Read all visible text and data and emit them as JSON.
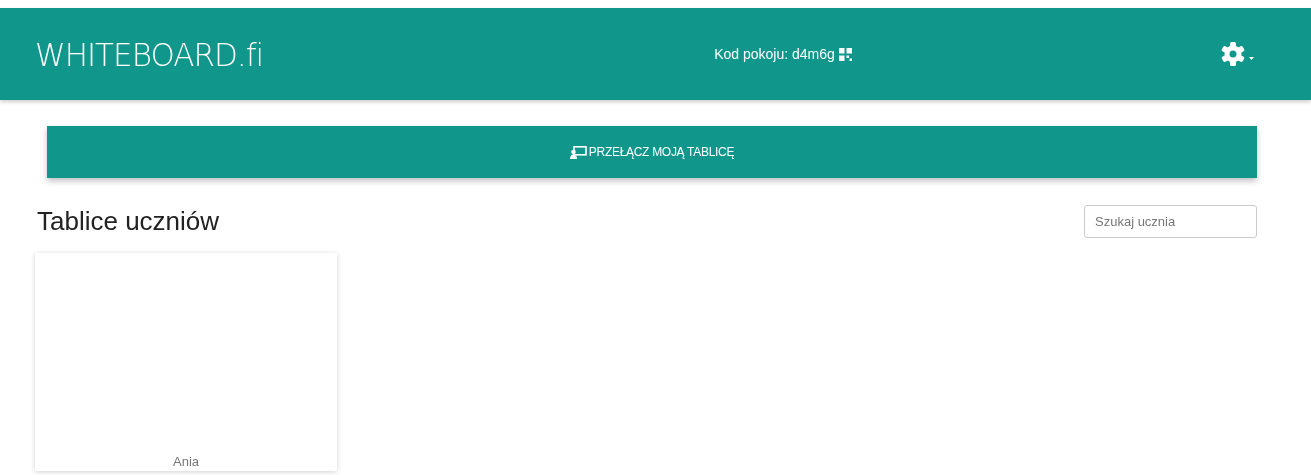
{
  "navbar": {
    "logo": "WHITEBOARD.fi",
    "room_code": "Kod pokoju: d4m6g"
  },
  "switch_button": {
    "label": "PRZEŁĄCZ MOJĄ TABLICĘ"
  },
  "section": {
    "title": "Tablice uczniów",
    "search": {
      "placeholder": "Szukaj ucznia"
    }
  },
  "boards": [
    {
      "name": "Ania"
    }
  ]
}
